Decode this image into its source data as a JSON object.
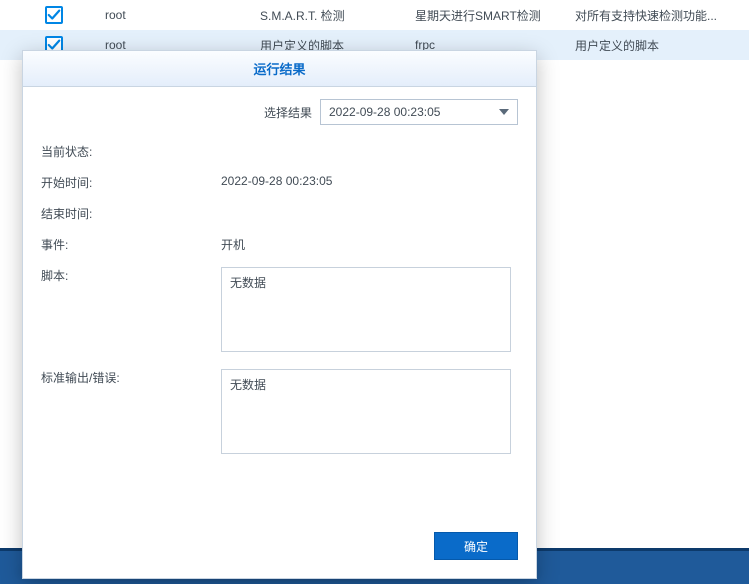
{
  "table": {
    "rows": [
      {
        "checked": true,
        "user": "root",
        "type": "S.M.A.R.T. 检测",
        "col3": "星期天进行SMART检测",
        "col4": "对所有支持快速检测功能..."
      },
      {
        "checked": true,
        "user": "root",
        "type": "用户定义的脚本",
        "col3": "frpc",
        "col4": "用户定义的脚本"
      }
    ]
  },
  "panel": {
    "title": "运行结果",
    "select_label": "选择结果",
    "select_value": "2022-09-28 00:23:05",
    "fields": {
      "status_label": "当前状态:",
      "status_value": "",
      "start_label": "开始时间:",
      "start_value": "2022-09-28 00:23:05",
      "end_label": "结束时间:",
      "end_value": "",
      "event_label": "事件:",
      "event_value": "开机",
      "script_label": "脚本:",
      "script_value": "无数据",
      "output_label": "标准输出/错误:",
      "output_value": "无数据"
    },
    "ok_button": "确定"
  }
}
